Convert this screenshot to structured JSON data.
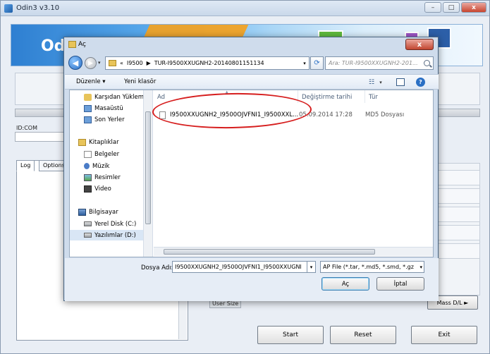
{
  "odin": {
    "title": "Odin3 v3.10",
    "banner_logo": "Od",
    "id_com_label": "ID:COM",
    "tabs": [
      "Log",
      "Options"
    ],
    "user_size_label": "User Size",
    "mass_dl_label": "Mass D/L ►",
    "buttons": {
      "start": "Start",
      "reset": "Reset",
      "exit": "Exit"
    },
    "window_buttons": {
      "minimize": "–",
      "maximize": "□",
      "close": "x"
    }
  },
  "dialog": {
    "title": "Aç",
    "close_label": "x",
    "breadcrumb": {
      "prefix": "«",
      "segments": [
        "I9500",
        "TUR-I9500XXUGNH2-20140801151134"
      ]
    },
    "search_placeholder": "Ara: TUR-I9500XXUGNH2-201...",
    "toolbar": {
      "organize": "Düzenle ▾",
      "new_folder": "Yeni klasör",
      "view_dd": "▾"
    },
    "nav": {
      "favorites": [
        "Karşıdan Yüklem",
        "Masaüstü",
        "Son Yerler"
      ],
      "libraries_label": "Kitaplıklar",
      "libraries": [
        "Belgeler",
        "Müzik",
        "Resimler",
        "Video"
      ],
      "computer_label": "Bilgisayar",
      "drives": [
        "Yerel Disk (C:)",
        "Yazılımlar (D:)"
      ]
    },
    "columns": {
      "name": "Ad",
      "date": "Değiştirme tarihi",
      "type": "Tür"
    },
    "files": [
      {
        "name": "I9500XXUGNH2_I9500OJVFNI1_I9500XXL...",
        "date": "05.09.2014 17:28",
        "type": "MD5 Dosyası"
      }
    ],
    "filename_label": "Dosya Adı:",
    "filename_value": "I9500XXUGNH2_I9500OJVFNI1_I9500XXUGNI",
    "filter_value": "AP File (*.tar, *.md5, *.smd, *.gz",
    "open_label": "Aç",
    "cancel_label": "İptal"
  },
  "colors": {
    "annotation": "#d61e1e",
    "title_bar": "#c9d8ea",
    "accent": "#2a6fc4"
  }
}
